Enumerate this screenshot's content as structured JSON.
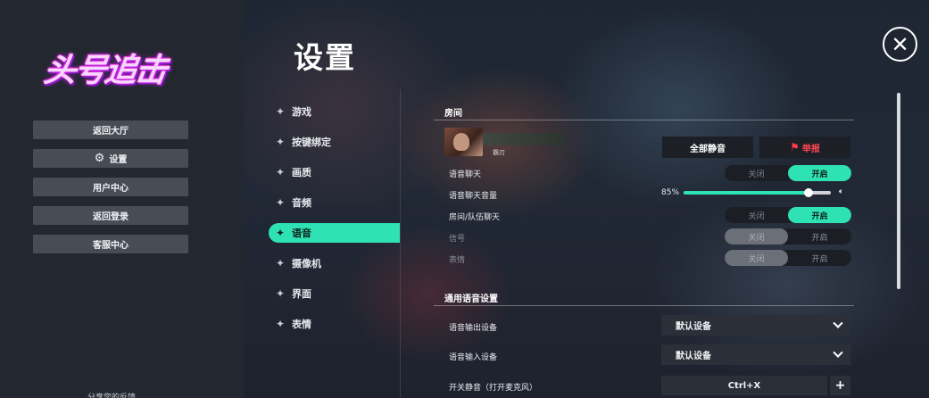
{
  "app": {
    "logo_text": "头号追击",
    "title": "设置",
    "close_icon": "✕"
  },
  "left_menu": {
    "items": [
      {
        "label": "返回大厅"
      },
      {
        "label": "设置",
        "icon": "gear-icon"
      },
      {
        "label": "用户中心"
      },
      {
        "label": "返回登录"
      },
      {
        "label": "客服中心"
      }
    ],
    "feedback": "分享您的反馈"
  },
  "categories": [
    {
      "label": "游戏"
    },
    {
      "label": "按键绑定"
    },
    {
      "label": "画质"
    },
    {
      "label": "音频"
    },
    {
      "label": "语音",
      "active": true
    },
    {
      "label": "摄像机"
    },
    {
      "label": "界面"
    },
    {
      "label": "表情"
    }
  ],
  "room": {
    "title": "房间",
    "player_tag": "霸刃",
    "mute_all": "全部静音",
    "report": "举报",
    "rows": {
      "voice_chat": {
        "label": "语音聊天",
        "off": "关闭",
        "on": "开启",
        "value": "on"
      },
      "voice_volume": {
        "label": "语音聊天音量",
        "value_text": "85%",
        "value": 0.85
      },
      "room_team_chat": {
        "label": "房间/队伍聊天",
        "off": "关闭",
        "on": "开启",
        "value": "on"
      },
      "signal": {
        "label": "信号",
        "off": "关闭",
        "on": "开启",
        "disabled": true
      },
      "emote": {
        "label": "表情",
        "off": "关闭",
        "on": "开启",
        "disabled": true
      }
    }
  },
  "general_voice": {
    "title": "通用语音设置",
    "output_device": {
      "label": "语音输出设备",
      "value": "默认设备"
    },
    "input_device": {
      "label": "语音输入设备",
      "value": "默认设备"
    },
    "mute_hotkey": {
      "label": "开关静音（打开麦克风）",
      "value": "Ctrl+X",
      "add": "+"
    }
  },
  "colors": {
    "accent": "#2fe2b3",
    "report": "#ff4654"
  }
}
